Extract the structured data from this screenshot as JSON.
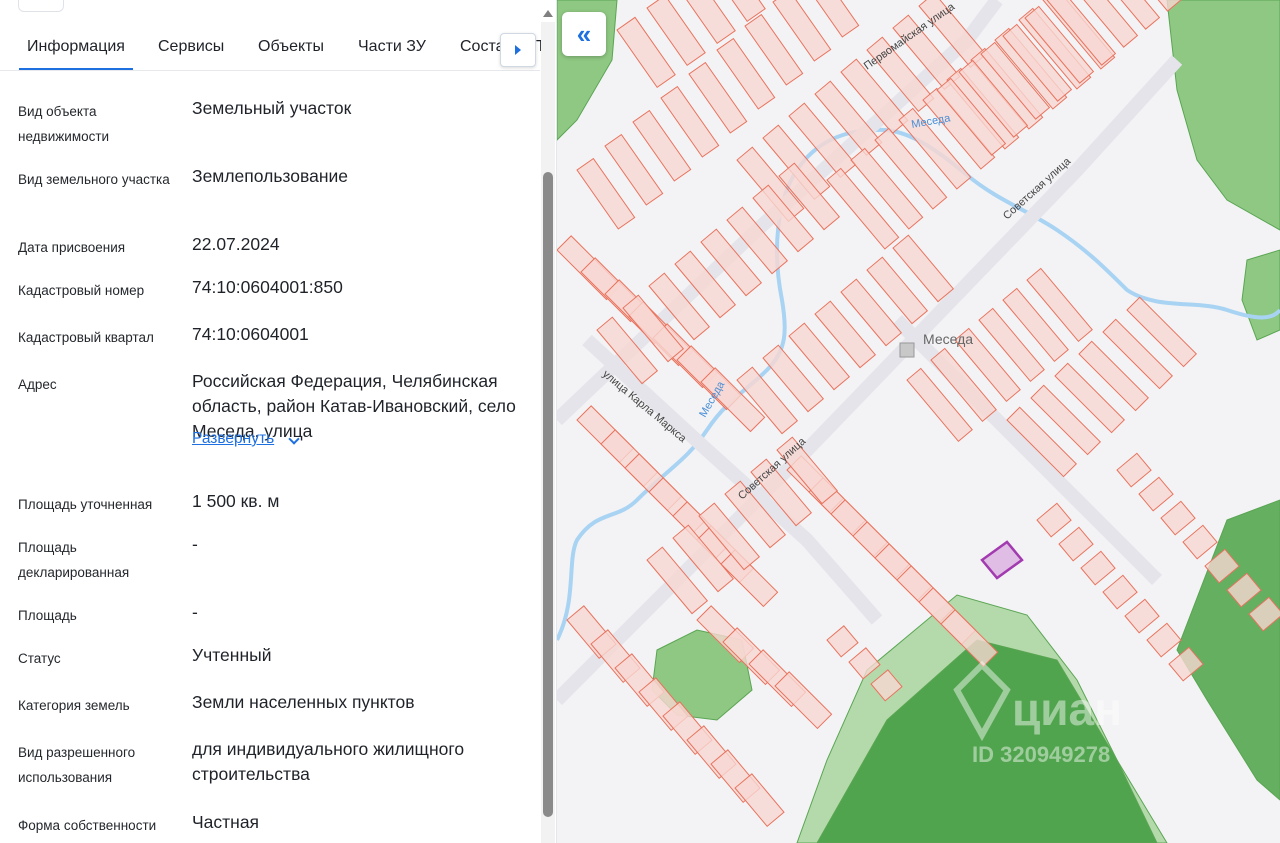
{
  "tabs": [
    {
      "label": "Информация"
    },
    {
      "label": "Сервисы"
    },
    {
      "label": "Объекты"
    },
    {
      "label": "Части ЗУ"
    },
    {
      "label": "Соста"
    }
  ],
  "tab_cut_letter": "Т",
  "info": {
    "object_type": {
      "label": "Вид объекта недвижимости",
      "value": "Земельный участок"
    },
    "land_type": {
      "label": "Вид земельного участка",
      "value": "Землепользование"
    },
    "assign_date": {
      "label": "Дата присвоения",
      "value": "22.07.2024"
    },
    "cadastral_number": {
      "label": "Кадастровый номер",
      "value": "74:10:0604001:850"
    },
    "cadastral_block": {
      "label": "Кадастровый квартал",
      "value": "74:10:0604001"
    },
    "address": {
      "label": "Адрес",
      "value": "Российская Федерация, Челябинская область, район Катав-Ивановский, село Меседа, улица",
      "expand_label": "Развернуть"
    },
    "area_refined": {
      "label": "Площадь уточненная",
      "value": "1 500 кв. м"
    },
    "area_declared": {
      "label": "Площадь декларированная",
      "value": "-"
    },
    "area": {
      "label": "Площадь",
      "value": "-"
    },
    "status": {
      "label": "Статус",
      "value": "Учтенный"
    },
    "land_category": {
      "label": "Категория земель",
      "value": "Земли населенных пунктов"
    },
    "permitted_use": {
      "label": "Вид разрешенного использования",
      "value": "для индивидуального жилищного строительства"
    },
    "ownership": {
      "label": "Форма собственности",
      "value": "Частная"
    }
  },
  "map": {
    "collapse_icon": "«",
    "labels": {
      "street_pervomayskaya": "Первомайская улица",
      "street_sovetskaya": "Советская улица",
      "street_marx": "улица Карла Маркса",
      "river": "Меседа",
      "village": "Меседа"
    },
    "watermark": "циан",
    "watermark_id": "ID 320949278",
    "colors": {
      "parcel_fill": "#f7d7d2",
      "parcel_stroke": "#e8745f",
      "selected_parcel": "#a23ab0",
      "forest": "#4fa84a",
      "river": "#a9d3f3"
    }
  }
}
